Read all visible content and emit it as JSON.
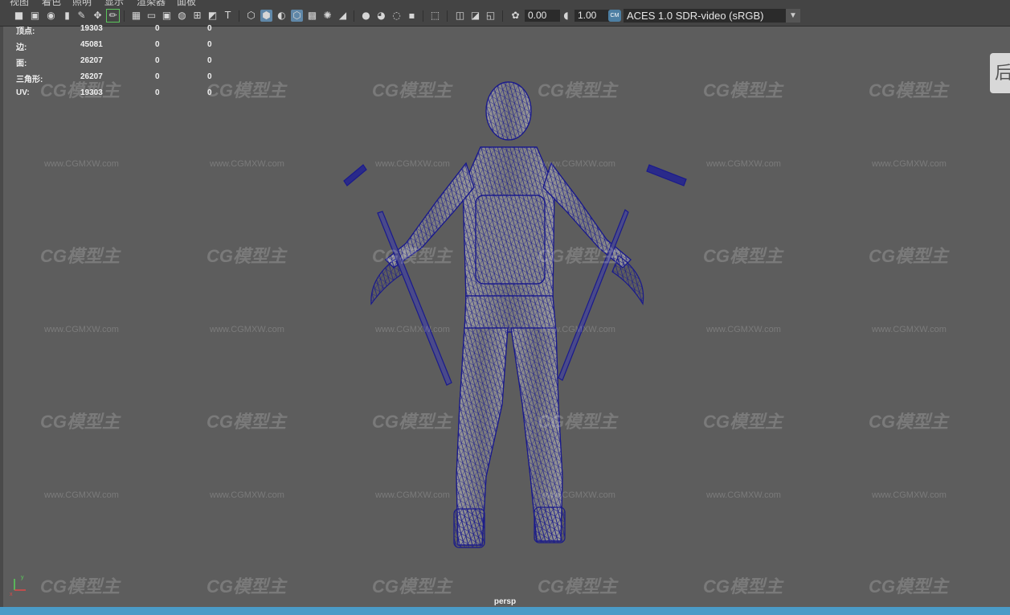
{
  "menu": [
    "视图",
    "着色",
    "照明",
    "显示",
    "渲染器",
    "面板"
  ],
  "toolbar": {
    "exposure": "0.00",
    "gamma": "1.00",
    "color_space_badge": "CM",
    "color_space": "ACES 1.0 SDR-video (sRGB)",
    "icons": [
      "camera-icon",
      "camera-attributes-icon",
      "bookmark-icon",
      "image-plane-icon",
      "grid-icon",
      "film-gate-icon",
      "resolution-gate-icon",
      "gate-mask-icon",
      "field-chart-icon",
      "safe-action-icon",
      "safe-title-icon",
      "wireframe-icon",
      "smooth-shade-icon",
      "flat-shade-icon",
      "wireframe-on-shaded-icon",
      "xray-icon",
      "textured-icon",
      "use-all-lights-icon",
      "shadows-icon",
      "screen-space-ao-icon",
      "motion-blur-icon",
      "multisample-aa-icon",
      "depth-of-field-icon",
      "isolate-select-icon",
      "xray-joints-icon",
      "xray-active-icon",
      "color-management-icon"
    ]
  },
  "hud": {
    "rows": [
      {
        "label": "顶点:",
        "v1": "19303",
        "v2": "0",
        "v3": "0"
      },
      {
        "label": "边:",
        "v1": "45081",
        "v2": "0",
        "v3": "0"
      },
      {
        "label": "面:",
        "v1": "26207",
        "v2": "0",
        "v3": "0"
      },
      {
        "label": "三角形:",
        "v1": "26207",
        "v2": "0",
        "v3": "0"
      },
      {
        "label": "UV:",
        "v1": "19303",
        "v2": "0",
        "v3": "0"
      }
    ]
  },
  "viewport": {
    "camera_label": "persp",
    "side_tab": "后",
    "wireframe_color": "#1a1a8c",
    "background_color": "#5d5d5d"
  },
  "watermark": {
    "logo": "CG模型主",
    "url": "www.CGMXW.com"
  },
  "axis": {
    "x_label": "x",
    "y_label": "y"
  },
  "statusbar": {
    "color": "#4a9bc7"
  }
}
